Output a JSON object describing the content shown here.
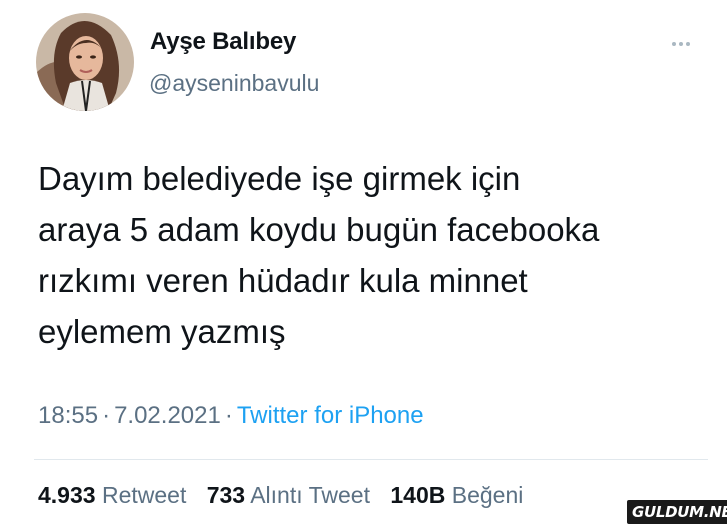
{
  "tweet": {
    "author": {
      "display_name": "Ayşe Balıbey",
      "handle": "@ayseninbavulu",
      "avatar": "profile-photo"
    },
    "more_icon": "more-horizontal-icon",
    "text_lines": [
      "Dayım belediyede işe girmek için",
      "araya 5 adam koydu bugün facebooka",
      "rızkımı veren hüdadır kula minnet",
      "eylemem yazmış"
    ],
    "time": "18:55",
    "date": "7.02.2021",
    "separator": "·",
    "source": "Twitter for iPhone",
    "stats": {
      "retweets_count": "4.933",
      "retweets_label": "Retweet",
      "quotes_count": "733",
      "quotes_label": "Alıntı Tweet",
      "likes_count": "140B",
      "likes_label": "Beğeni"
    }
  },
  "watermark": {
    "text": "GULDUM.NET"
  },
  "colors": {
    "text": "#0f1419",
    "secondary": "#5b7083",
    "link": "#1da1f2",
    "divider": "#e1e8ed"
  }
}
